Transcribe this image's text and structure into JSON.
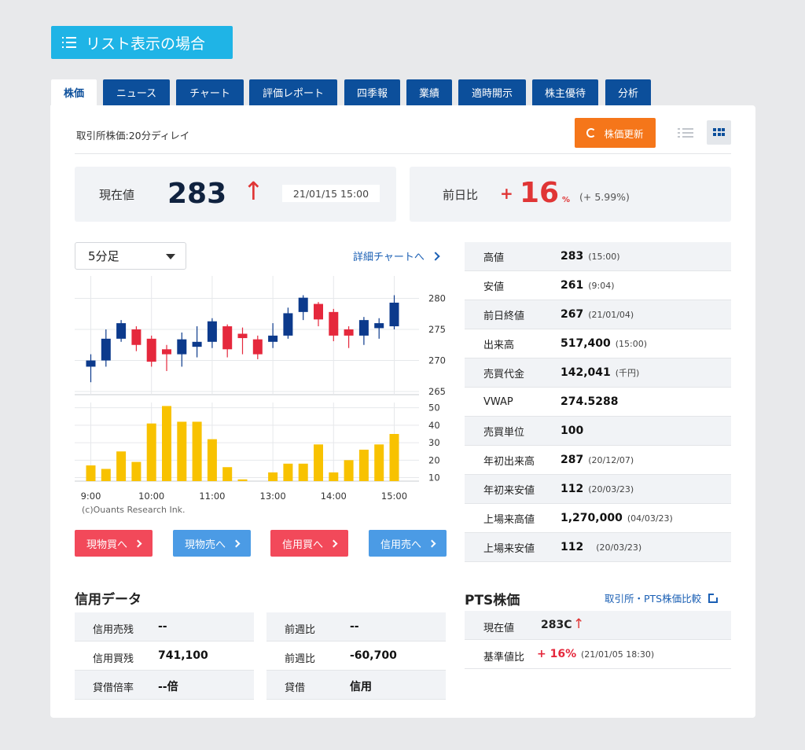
{
  "header": {
    "badge_label": "リスト表示の場合"
  },
  "tabs": [
    "株価",
    "ニュース",
    "チャート",
    "評価レポート",
    "四季報",
    "業績",
    "適時開示",
    "株主優待",
    "分析"
  ],
  "toolbar": {
    "delay_note": "取引所株価:20分ディレイ",
    "refresh_label": "株価更新"
  },
  "price": {
    "label": "現在値",
    "value": "283",
    "arrow": "↑",
    "datetime": "21/01/15 15:00",
    "change_label": "前日比",
    "change_sign": "+",
    "change_value": "16",
    "change_unit": "%",
    "change_pct": "(+ 5.99%)"
  },
  "chart_controls": {
    "interval": "5分足",
    "detail_link": "詳細チャートへ"
  },
  "chart_data": {
    "type": "candlestick",
    "x_labels": [
      "9:00",
      "10:00",
      "11:00",
      "13:00",
      "14:00",
      "15:00"
    ],
    "price_ticks": [
      280,
      275,
      270,
      265
    ],
    "volume_ticks": [
      50,
      40,
      30,
      20,
      10
    ],
    "candles": [
      {
        "o": 269,
        "c": 270,
        "h": 271,
        "l": 266.5
      },
      {
        "o": 270,
        "c": 273.5,
        "h": 275,
        "l": 269
      },
      {
        "o": 273.5,
        "c": 276,
        "h": 276.5,
        "l": 273
      },
      {
        "o": 275,
        "c": 272.5,
        "h": 275.5,
        "l": 271.5
      },
      {
        "o": 273.5,
        "c": 269.8,
        "h": 274,
        "l": 269
      },
      {
        "o": 271.8,
        "c": 271,
        "h": 272.5,
        "l": 268.3
      },
      {
        "o": 271,
        "c": 273.4,
        "h": 274.5,
        "l": 269
      },
      {
        "o": 272.2,
        "c": 273,
        "h": 275.5,
        "l": 270.5
      },
      {
        "o": 273,
        "c": 276.3,
        "h": 276.8,
        "l": 272
      },
      {
        "o": 275.5,
        "c": 271.8,
        "h": 275.8,
        "l": 270.5
      },
      {
        "o": 274.3,
        "c": 273.6,
        "h": 275.3,
        "l": 271
      },
      {
        "o": 273.4,
        "c": 271,
        "h": 274,
        "l": 270.2
      },
      {
        "o": 273,
        "c": 274,
        "h": 276,
        "l": 272
      },
      {
        "o": 274,
        "c": 277.6,
        "h": 278.5,
        "l": 273.5
      },
      {
        "o": 277.8,
        "c": 280.1,
        "h": 280.5,
        "l": 276.5
      },
      {
        "o": 279.1,
        "c": 276.6,
        "h": 279.4,
        "l": 275.5
      },
      {
        "o": 277.8,
        "c": 274,
        "h": 278.3,
        "l": 273.1
      },
      {
        "o": 275,
        "c": 274,
        "h": 275.5,
        "l": 272
      },
      {
        "o": 274,
        "c": 276.5,
        "h": 277,
        "l": 272.5
      },
      {
        "o": 275.2,
        "c": 276,
        "h": 276.8,
        "l": 273.5
      },
      {
        "o": 275.5,
        "c": 279.3,
        "h": 280.5,
        "l": 275
      }
    ],
    "volumes": [
      17,
      15,
      25,
      19,
      41,
      51,
      42,
      42,
      32,
      16,
      9,
      7,
      13,
      18,
      18,
      29,
      13,
      20,
      26,
      29,
      35
    ],
    "credit": "(c)Ouants Research Ink."
  },
  "trade_buttons": [
    "現物買へ",
    "現物売へ",
    "信用買へ",
    "信用売へ"
  ],
  "stats": [
    {
      "label": "高値",
      "value": "283",
      "sub": "(15:00)"
    },
    {
      "label": "安値",
      "value": "261",
      "sub": "(9:04)"
    },
    {
      "label": "前日終値",
      "value": "267",
      "sub": "(21/01/04)"
    },
    {
      "label": "出来高",
      "value": "517,400",
      "sub": "(15:00)"
    },
    {
      "label": "売買代金",
      "value": "142,041",
      "sub": "(千円)"
    },
    {
      "label": "VWAP",
      "value": "274.5288",
      "sub": ""
    },
    {
      "label": "売買単位",
      "value": "100",
      "sub": ""
    },
    {
      "label": "年初出来高",
      "value": "287",
      "sub": "(20/12/07)"
    },
    {
      "label": "年初来安値",
      "value": "112",
      "sub": "(20/03/23)"
    },
    {
      "label": "上場来高値",
      "value": "1,270,000",
      "sub": "(04/03/23)"
    },
    {
      "label": "上場来安値",
      "value": "112",
      "sub": "(20/03/23)"
    }
  ],
  "margin": {
    "title": "信用データ",
    "left": [
      {
        "label": "信用売残",
        "value": "--"
      },
      {
        "label": "信用買残",
        "value": "741,100"
      },
      {
        "label": "貸借倍率",
        "value": "--倍"
      }
    ],
    "right": [
      {
        "label": "前週比",
        "value": "--"
      },
      {
        "label": "前週比",
        "value": "-60,700"
      },
      {
        "label": "貸借",
        "value": "信用"
      }
    ]
  },
  "pts": {
    "title": "PTS株価",
    "link": "取引所・PTS株価比較",
    "current_label": "現在値",
    "current_value": "283C",
    "current_arrow": "↑",
    "base_label": "基準値比",
    "base_value": "+ 16%",
    "base_sub": "(21/01/05 18:30)"
  },
  "colors": {
    "up": "#0c3a8c",
    "down": "#e5283c",
    "volume": "#f8c200",
    "accent": "#1fb4e6",
    "tab": "#0c4f9b",
    "refresh": "#f5761a"
  }
}
